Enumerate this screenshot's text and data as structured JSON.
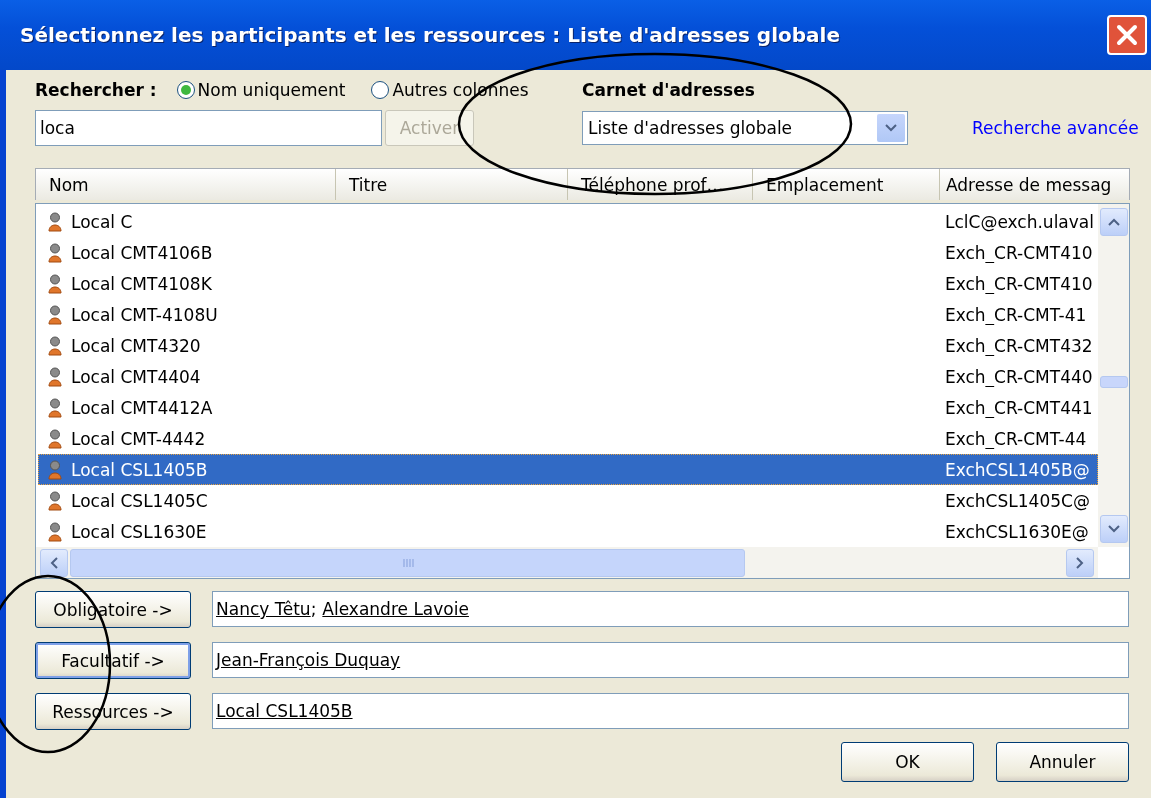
{
  "window": {
    "title": "Sélectionnez les participants et les ressources : Liste d'adresses globale"
  },
  "search": {
    "label": "Rechercher :",
    "options": [
      {
        "label": "Nom uniquement",
        "selected": true
      },
      {
        "label": "Autres colonnes",
        "selected": false
      }
    ],
    "value": "loca",
    "go_button": {
      "label": "Activer",
      "disabled": true
    }
  },
  "address_book": {
    "label": "Carnet d'adresses",
    "value": "Liste d'adresses globale",
    "advanced_link": "Recherche avancée"
  },
  "table": {
    "columns": [
      "Nom",
      "Titre",
      "Téléphone prof…",
      "Emplacement",
      "Adresse de messag"
    ],
    "rows": [
      {
        "name": "Local C",
        "address": "LclC@exch.ulaval",
        "selected": false
      },
      {
        "name": "Local CMT4106B",
        "address": "Exch_CR-CMT410",
        "selected": false
      },
      {
        "name": "Local CMT4108K",
        "address": "Exch_CR-CMT410",
        "selected": false
      },
      {
        "name": "Local CMT-4108U",
        "address": "Exch_CR-CMT-41",
        "selected": false
      },
      {
        "name": "Local CMT4320",
        "address": "Exch_CR-CMT432",
        "selected": false
      },
      {
        "name": "Local CMT4404",
        "address": "Exch_CR-CMT440",
        "selected": false
      },
      {
        "name": "Local CMT4412A",
        "address": "Exch_CR-CMT441",
        "selected": false
      },
      {
        "name": "Local CMT-4442",
        "address": "Exch_CR-CMT-44",
        "selected": false
      },
      {
        "name": "Local CSL1405B",
        "address": "ExchCSL1405B@",
        "selected": true
      },
      {
        "name": "Local CSL1405C",
        "address": "ExchCSL1405C@",
        "selected": false
      },
      {
        "name": "Local CSL1630E",
        "address": "ExchCSL1630E@",
        "selected": false
      }
    ]
  },
  "recipients": {
    "separator": ";",
    "rows": [
      {
        "button": "Obligatoire ->",
        "focused": false,
        "names": [
          "Nancy Têtu",
          "Alexandre Lavoie"
        ]
      },
      {
        "button": "Facultatif ->",
        "focused": true,
        "names": [
          "Jean-François Duquay"
        ]
      },
      {
        "button": "Ressources ->",
        "focused": false,
        "names": [
          "Local CSL1405B"
        ]
      }
    ]
  },
  "buttons": [
    "OK",
    "Annuler"
  ],
  "annotations": [
    {
      "kind": "ellipse"
    },
    {
      "kind": "ellipse"
    }
  ]
}
